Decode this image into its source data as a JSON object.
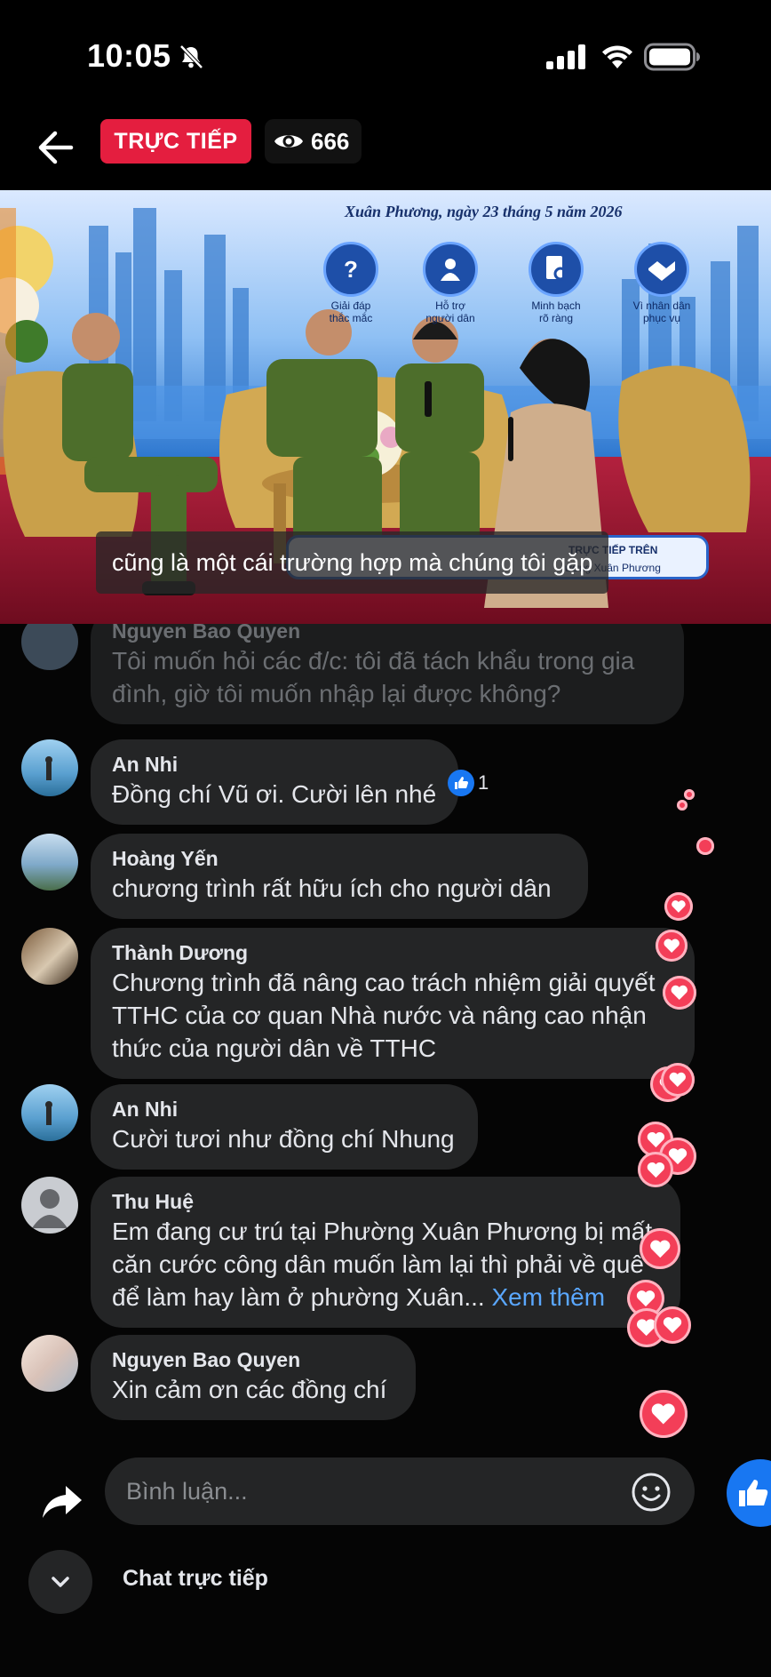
{
  "status_bar": {
    "time": "10:05",
    "icons": [
      "bell-slash-icon",
      "signal-icon",
      "wifi-icon",
      "battery-icon"
    ]
  },
  "header": {
    "live_label": "TRỰC TIẾP",
    "viewer_count": "666",
    "icons": [
      "back-arrow-icon",
      "eye-icon"
    ]
  },
  "video": {
    "event_title": "Xuân Phương, ngày 23 tháng 5 năm 2026",
    "features": [
      {
        "icon": "question-icon",
        "label": "Giải đáp\nthắc mắc"
      },
      {
        "icon": "people-icon",
        "label": "Hỗ trợ\nngười dân"
      },
      {
        "icon": "document-search-icon",
        "label": "Minh bạch\nrõ ràng"
      },
      {
        "icon": "handshake-icon",
        "label": "Vì nhân dân\nphục vụ"
      }
    ],
    "banner_title": "TRỰC TIẾP TRÊN",
    "banner_subtitle": "ường Xuân Phương",
    "caption": "cũng là một cái trường hợp mà chúng tôi gặp"
  },
  "comments": [
    {
      "name": "Nguyen Bao Quyen",
      "text": "Tôi muốn hỏi các đ/c: tôi đã tách khẩu trong gia đình, giờ tôi muốn nhập lại được không?",
      "faded": true
    },
    {
      "name": "An Nhi",
      "text": "Đồng chí Vũ ơi. Cười lên nhé",
      "likes": "1"
    },
    {
      "name": "Hoàng Yến",
      "text": "chương trình rất hữu ích cho người dân"
    },
    {
      "name": "Thành Dương",
      "text": "Chương trình đã nâng cao trách nhiệm giải quyết TTHC của cơ quan Nhà nước và nâng cao nhận thức của người dân về TTHC"
    },
    {
      "name": "An Nhi",
      "text": "Cười tươi như đồng chí Nhung"
    },
    {
      "name": "Thu Huệ",
      "text": "Em đang cư trú tại Phường Xuân Phương bị mất căn cước công dân muốn làm lại thì phải về quê để làm hay làm ở phường Xuân...",
      "see_more": "Xem thêm"
    },
    {
      "name": "Nguyen Bao Quyen",
      "text": "Xin cảm ơn các đồng chí"
    }
  ],
  "composer": {
    "placeholder": "Bình luận...",
    "chat_label": "Chat trực tiếp",
    "icons": [
      "share-icon",
      "emoji-icon",
      "like-icon",
      "chevron-down-icon"
    ]
  },
  "colors": {
    "live_red": "#e41e3f",
    "like_blue": "#1877f2",
    "heart_red": "#f33e58",
    "bubble_bg": "#242526",
    "link_blue": "#5aa7ff"
  }
}
